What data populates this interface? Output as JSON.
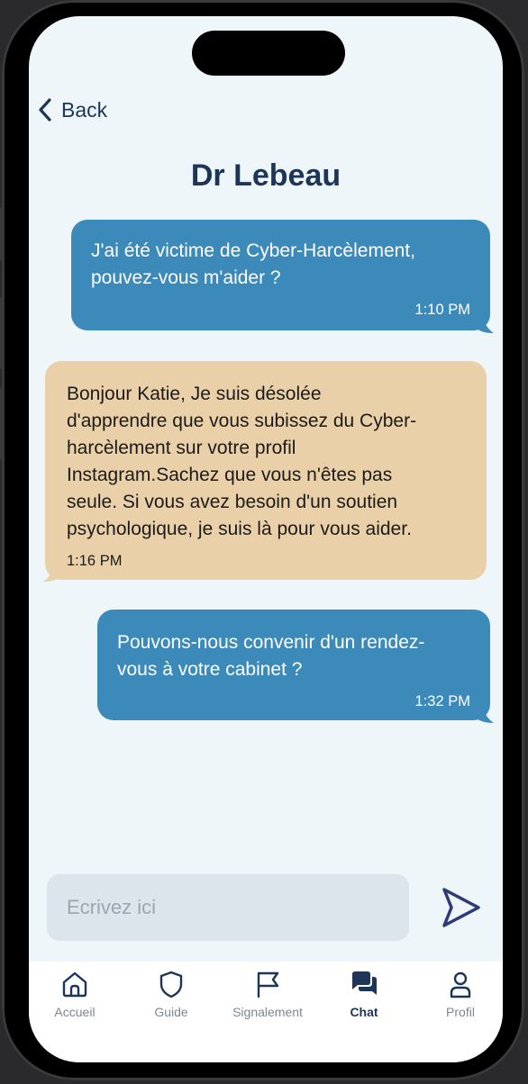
{
  "header": {
    "back_label": "Back",
    "title": "Dr Lebeau"
  },
  "messages": [
    {
      "from": "me",
      "text": "J'ai été victime de Cyber-Harcèlement,\npouvez-vous m'aider ?",
      "time": "1:10 PM"
    },
    {
      "from": "doctor",
      "text": "Bonjour Katie, Je suis désolée\nd'apprendre que vous subissez du Cyber-\nharcèlement sur votre profil\nInstagram.Sachez que vous n'êtes pas\nseule. Si vous avez besoin d'un soutien\npsychologique, je suis là pour vous aider.",
      "time": "1:16 PM"
    },
    {
      "from": "me",
      "text": "Pouvons-nous convenir d'un rendez-\nvous à votre cabinet ?",
      "time": "1:32 PM"
    }
  ],
  "composer": {
    "placeholder": "Ecrivez ici",
    "value": ""
  },
  "tabs": [
    {
      "label": "Accueil",
      "icon": "home-icon",
      "active": false
    },
    {
      "label": "Guide",
      "icon": "shield-icon",
      "active": false
    },
    {
      "label": "Signalement",
      "icon": "flag-icon",
      "active": false
    },
    {
      "label": "Chat",
      "icon": "chat-bubbles-icon",
      "active": true
    },
    {
      "label": "Profil",
      "icon": "user-icon",
      "active": false
    }
  ],
  "colors": {
    "sent_bubble": "#3b8ab9",
    "received_bubble": "#ead0a8",
    "navy": "#1d3557",
    "background": "#eef6fa"
  }
}
